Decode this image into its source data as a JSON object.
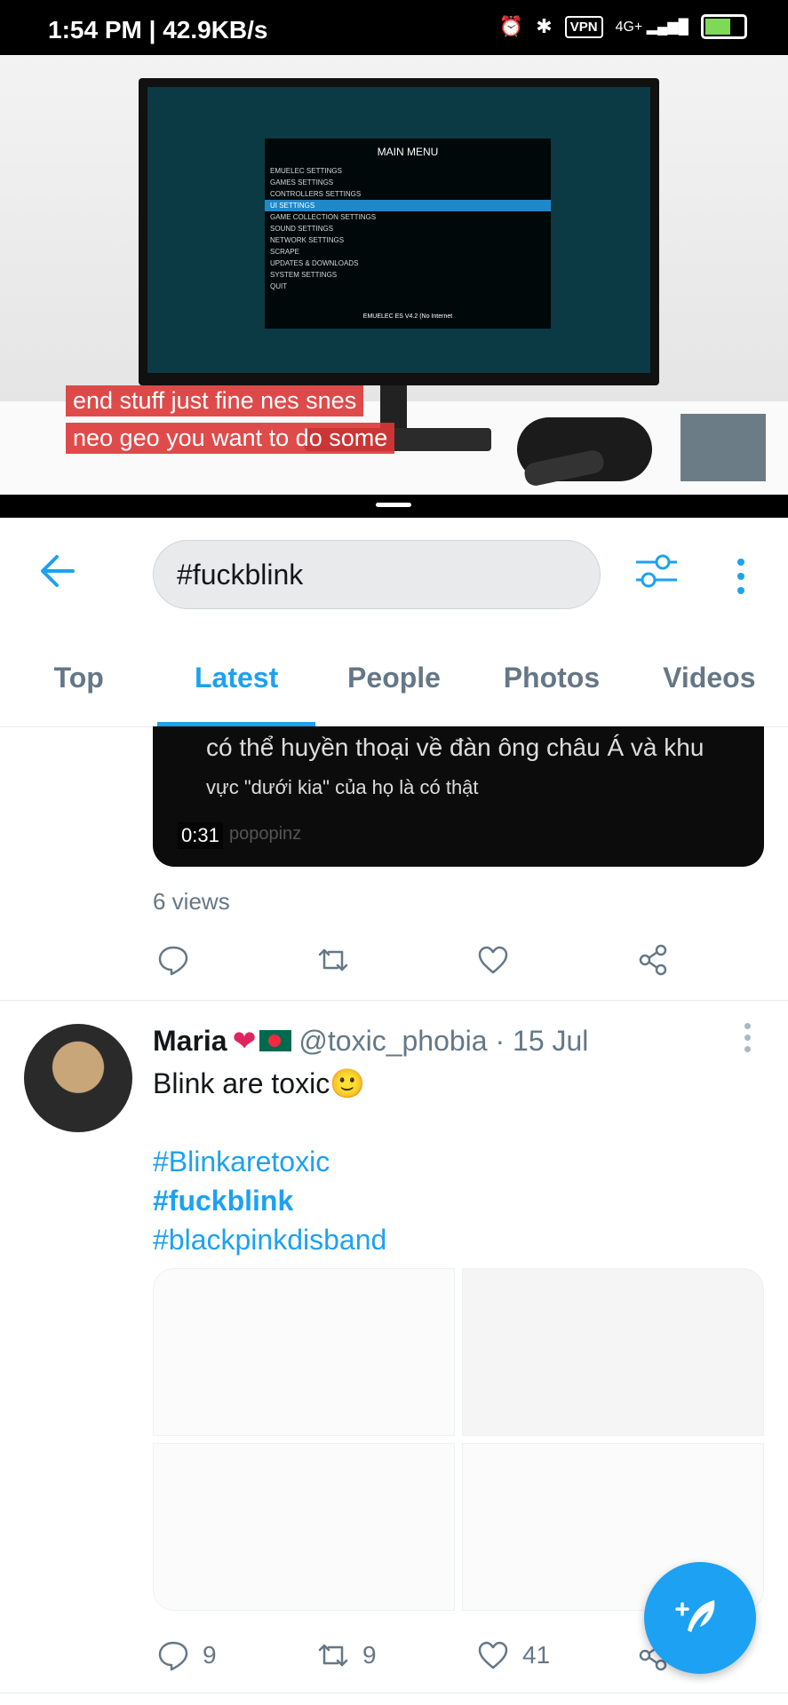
{
  "status_bar": {
    "time": "1:54 PM | 42.9KB/s",
    "vpn": "VPN",
    "network": "4G+"
  },
  "video_pip": {
    "menu_title": "MAIN MENU",
    "menu_items": [
      "EMUELEC SETTINGS",
      "GAMES SETTINGS",
      "CONTROLLERS SETTINGS",
      "UI SETTINGS",
      "GAME COLLECTION SETTINGS",
      "SOUND SETTINGS",
      "NETWORK SETTINGS",
      "SCRAPE",
      "UPDATES & DOWNLOADS",
      "SYSTEM SETTINGS",
      "QUIT"
    ],
    "version": "EMUELEC ES V4.2 (No Internet",
    "caption_line1": "end stuff just fine nes snes",
    "caption_line2": "neo geo you want to do some"
  },
  "search": {
    "query": "#fuckblink"
  },
  "tabs": [
    "Top",
    "Latest",
    "People",
    "Photos",
    "Videos"
  ],
  "tweet1": {
    "video_line1": "có thể huyền thoại về đàn ông châu Á và khu",
    "video_line2": "vực \"dưới kia\" của họ là có thật",
    "watermark": "popopinz",
    "duration": "0:31",
    "views": "6 views"
  },
  "tweet2": {
    "name": "Maria",
    "handle": "@toxic_phobia · 15 Jul",
    "text": "Blink are toxic🙂",
    "hashtags": [
      "#Blinkaretoxic",
      "#fuckblink",
      "#blackpinkdisband"
    ],
    "replies": "9",
    "retweets": "9",
    "likes": "41"
  },
  "colors": {
    "accent": "#1da1f2",
    "text": "#14171a",
    "muted": "#657786"
  }
}
